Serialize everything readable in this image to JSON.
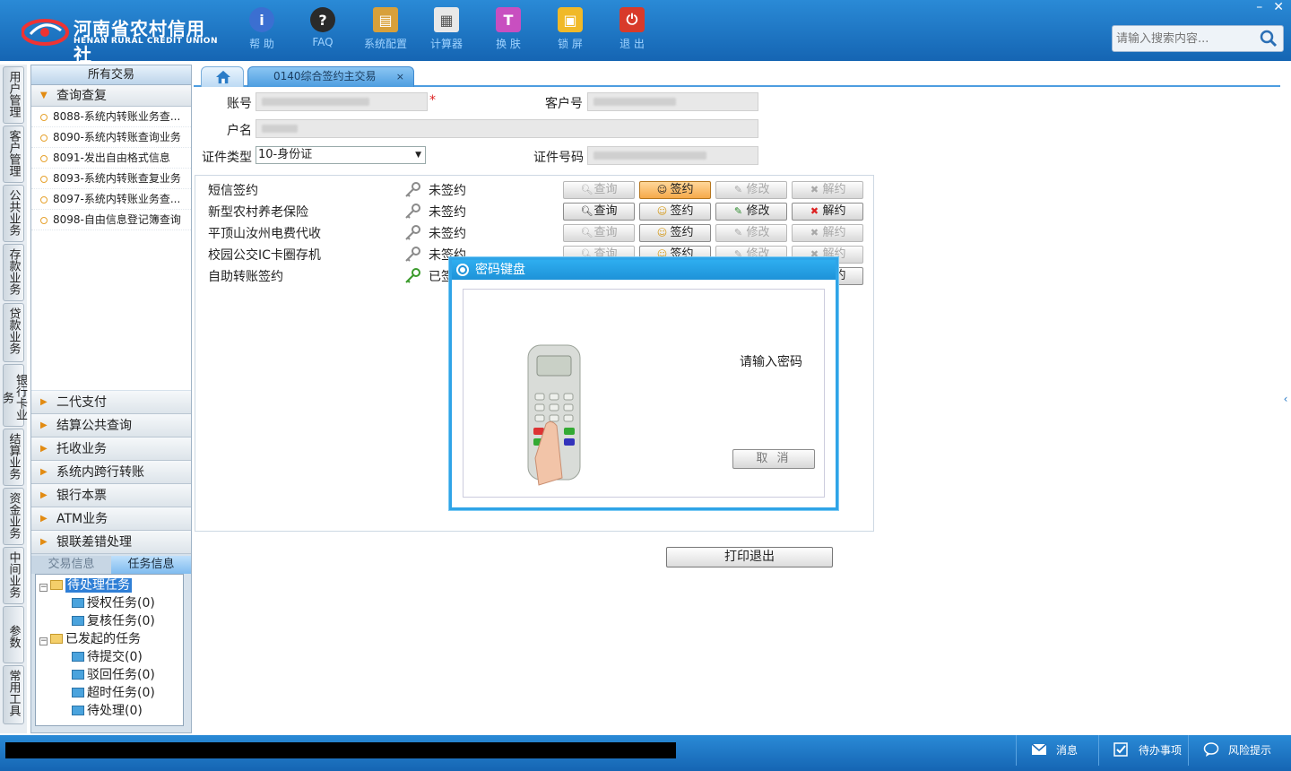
{
  "app": {
    "logo_cn": "河南省农村信用社",
    "logo_en": "HENAN RURAL CREDIT UNION"
  },
  "toolbar": [
    {
      "label": "帮 助",
      "icon": "info-icon",
      "color": "#3b6fd1"
    },
    {
      "label": "FAQ",
      "icon": "question-icon",
      "color": "#2a2a2a"
    },
    {
      "label": "系统配置",
      "icon": "toolbox-icon",
      "color": "#d8a03a"
    },
    {
      "label": "计算器",
      "icon": "calculator-icon",
      "color": "#e8e8e8"
    },
    {
      "label": "换 肤",
      "icon": "shirt-icon",
      "color": "#c84fc0"
    },
    {
      "label": "锁 屏",
      "icon": "lock-icon",
      "color": "#f0b928"
    },
    {
      "label": "退 出",
      "icon": "power-icon",
      "color": "#d83a2a"
    }
  ],
  "window_controls": {
    "minimize": "–",
    "close": "✕"
  },
  "search": {
    "placeholder": "请输入搜索内容..."
  },
  "vertical_tabs": [
    "用户管理",
    "客户管理",
    "公共业务",
    "存款业务",
    "贷款业务",
    "银行卡业务",
    "结算业务",
    "资金业务",
    "中间业务",
    "参数",
    "常用工具"
  ],
  "left_panel": {
    "all_header": "所有交易",
    "query_group": "查询查复",
    "query_items": [
      "8088-系统内转账业务查...",
      "8090-系统内转账查询业务",
      "8091-发出自由格式信息",
      "8093-系统内转账查复业务",
      "8097-系统内转账业务查...",
      "8098-自由信息登记簿查询"
    ],
    "categories": [
      "二代支付",
      "结算公共查询",
      "托收业务",
      "系统内跨行转账",
      "银行本票",
      "ATM业务",
      "银联差错处理"
    ],
    "info_tabs": [
      "交易信息",
      "任务信息"
    ],
    "tree": {
      "pending": "待处理任务",
      "pending_children": [
        "授权任务(0)",
        "复核任务(0)"
      ],
      "initiated": "已发起的任务",
      "initiated_children": [
        "待提交(0)",
        "驳回任务(0)",
        "超时任务(0)",
        "待处理(0)"
      ]
    }
  },
  "tabs": {
    "main": "0140综合签约主交易",
    "close": "×"
  },
  "form": {
    "account_label": "账号",
    "required_mark": "*",
    "customer_no_label": "客户号",
    "name_label": "户名",
    "cert_type_label": "证件类型",
    "cert_type_value": "10-身份证",
    "cert_no_label": "证件号码"
  },
  "services": [
    {
      "name": "短信签约",
      "status": "未签约",
      "signed": false
    },
    {
      "name": "新型农村养老保险",
      "status": "未签约",
      "signed": false
    },
    {
      "name": "平顶山汝州电费代收",
      "status": "未签约",
      "signed": false
    },
    {
      "name": "校园公交IC卡圈存机",
      "status": "未签约",
      "signed": false
    },
    {
      "name": "自助转账签约",
      "status": "已签约",
      "signed": true
    }
  ],
  "actions": {
    "query": "查询",
    "sign": "签约",
    "modify": "修改",
    "cancel_sign": "解约"
  },
  "print_button": "打印退出",
  "dialog": {
    "title": "密码键盘",
    "message": "请输入密码",
    "cancel": "取 消"
  },
  "status_bar": {
    "messages": "消息",
    "todo": "待办事项",
    "risk": "风险提示"
  }
}
